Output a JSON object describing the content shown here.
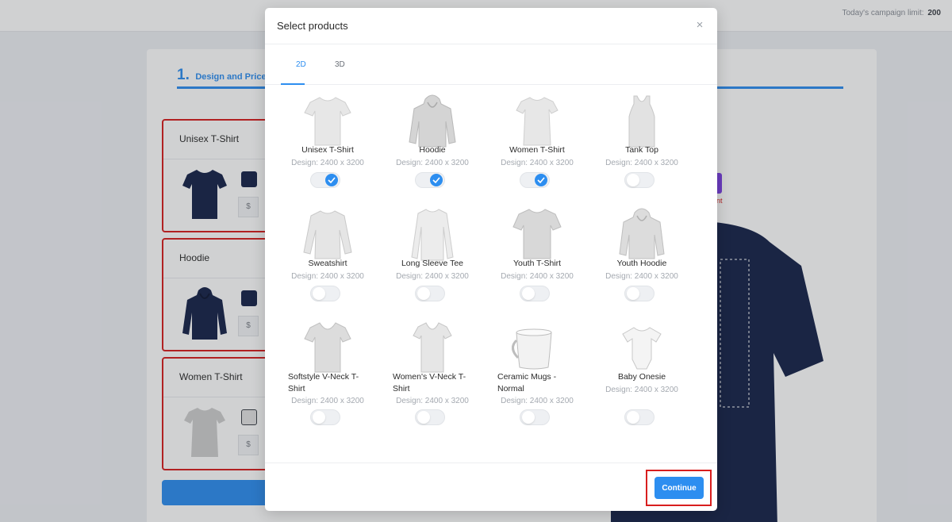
{
  "header": {
    "limit_label": "Today's campaign limit:",
    "limit_value": "200"
  },
  "steps": {
    "step_number": "1.",
    "step_label": "Design and Price"
  },
  "side_products": [
    {
      "name": "Unisex T-Shirt",
      "price_prefix": "$"
    },
    {
      "name": "Hoodie",
      "price_prefix": "$"
    },
    {
      "name": "Women T-Shirt",
      "price_prefix": "$"
    }
  ],
  "preview": {
    "fragment_text": "nt"
  },
  "modal": {
    "title": "Select products",
    "close_symbol": "×",
    "tabs": [
      {
        "label": "2D",
        "active": true
      },
      {
        "label": "3D",
        "active": false
      }
    ],
    "products": [
      {
        "name": "Unisex T-Shirt",
        "design": "Design: 2400 x 3200",
        "selected": true,
        "icon": "tshirt-icon"
      },
      {
        "name": "Hoodie",
        "design": "Design: 2400 x 3200",
        "selected": true,
        "icon": "hoodie-icon"
      },
      {
        "name": "Women T-Shirt",
        "design": "Design: 2400 x 3200",
        "selected": true,
        "icon": "women-tshirt-icon"
      },
      {
        "name": "Tank Top",
        "design": "Design: 2400 x 3200",
        "selected": false,
        "icon": "tank-top-icon"
      },
      {
        "name": "Sweatshirt",
        "design": "Design: 2400 x 3200",
        "selected": false,
        "icon": "sweatshirt-icon"
      },
      {
        "name": "Long Sleeve Tee",
        "design": "Design: 2400 x 3200",
        "selected": false,
        "icon": "long-sleeve-icon"
      },
      {
        "name": "Youth T-Shirt",
        "design": "Design: 2400 x 3200",
        "selected": false,
        "icon": "youth-tshirt-icon"
      },
      {
        "name": "Youth Hoodie",
        "design": "Design: 2400 x 3200",
        "selected": false,
        "icon": "youth-hoodie-icon"
      },
      {
        "name": "Softstyle V-Neck T-Shirt",
        "design": "Design: 2400 x 3200",
        "selected": false,
        "icon": "vneck-icon"
      },
      {
        "name": "Women's V-Neck T-Shirt",
        "design": "Design: 2400 x 3200",
        "selected": false,
        "icon": "women-vneck-icon"
      },
      {
        "name": "Ceramic Mugs - Normal",
        "design": "Design: 2400 x 3200",
        "selected": false,
        "icon": "mug-icon"
      },
      {
        "name": "Baby Onesie",
        "design": "Design: 2400 x 3200",
        "selected": false,
        "icon": "onesie-icon"
      }
    ],
    "continue_label": "Continue"
  },
  "colors": {
    "accent": "#2d8ef0",
    "highlight_border": "#d81e1e",
    "navy_garment": "#16234a",
    "garment_white": "#e7e7e7"
  }
}
